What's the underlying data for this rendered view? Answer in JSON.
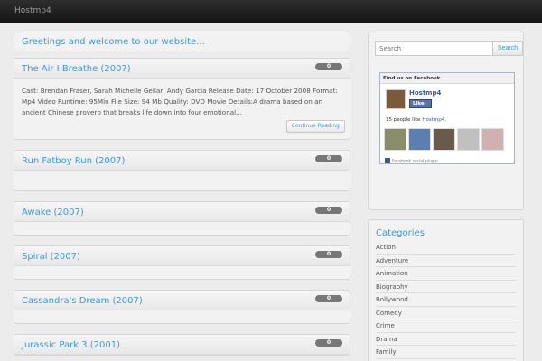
{
  "site": {
    "brand": "Hostmp4"
  },
  "main": {
    "greeting": "Greetings and welcome to our website...",
    "featured": {
      "title": "The Air I Breathe (2007)",
      "count": "0",
      "excerpt": "Cast: Brendan Fraser, Sarah Michelle Gellar, Andy Garcia Release Date: 17 October 2008 Format: Mp4 Video Runtime: 95Min File Size: 94 Mb Quality: DVD Movie Details:A drama based on an ancient Chinese proverb that breaks life down into four emotional...",
      "read_more": "Continue Reading"
    },
    "posts": [
      {
        "title": "Run Fatboy Run (2007)",
        "count": "0"
      },
      {
        "title": "Awake (2007)",
        "count": "0"
      },
      {
        "title": "Spiral (2007)",
        "count": "0"
      },
      {
        "title": "Cassandra's Dream (2007)",
        "count": "0"
      },
      {
        "title": "Jurassic Park 3 (2001)",
        "count": "0"
      }
    ]
  },
  "sidebar": {
    "search": {
      "placeholder": "Search",
      "button": "Search"
    },
    "facebook": {
      "header": "Find us on Facebook",
      "page_name": "Hostmp4",
      "like_label": "Like",
      "count_prefix": "15 people like",
      "count_page": "Hostmp4",
      "count_suffix": ".",
      "plugin_label": "Facebook social plugin",
      "face_colors": [
        "#8a8f6a",
        "#5a7fb0",
        "#6a5a4a",
        "#c0c0c0",
        "#d0b0b0"
      ]
    },
    "categories": {
      "title": "Categories",
      "items": [
        "Action",
        "Adventure",
        "Animation",
        "Biography",
        "Bollywood",
        "Comedy",
        "Crime",
        "Drama",
        "Family"
      ]
    }
  },
  "colors": {
    "accent": "#3a9bd9",
    "topbar": "#1c1c1c",
    "facebook": "#3b5998"
  }
}
